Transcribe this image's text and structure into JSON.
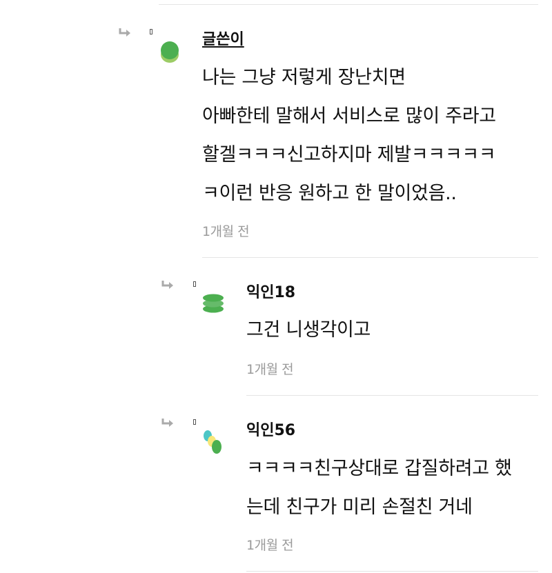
{
  "comments": [
    {
      "author": "글쓴이",
      "lines": [
        "나는 그냥 저렇게 장난치면",
        "아빠한테 말해서 서비스로 많이 주라고",
        "할겔ㅋㅋㅋ신고하지마 제발ㅋㅋㅋㅋㅋ",
        "ㅋ이런 반응 원하고 한 말이었음.."
      ],
      "time": "1개월 전"
    },
    {
      "author": "익인18",
      "lines": [
        "그건 니생각이고"
      ],
      "time": "1개월 전"
    },
    {
      "author": "익인56",
      "lines": [
        "ㅋㅋㅋㅋ친구상대로 갑질하려고 했",
        "는데 친구가 미리 손절친 거네"
      ],
      "time": "1개월 전"
    }
  ],
  "icons": {
    "reply": "reply-arrow-icon",
    "menu": "more-options-icon"
  },
  "colors": {
    "green": "#4caf50",
    "light_green": "#9ccc65",
    "teal": "#4dc6c6",
    "yellow": "#f7e77a",
    "divider": "#e4e4e4",
    "meta": "#9a9a9a"
  }
}
